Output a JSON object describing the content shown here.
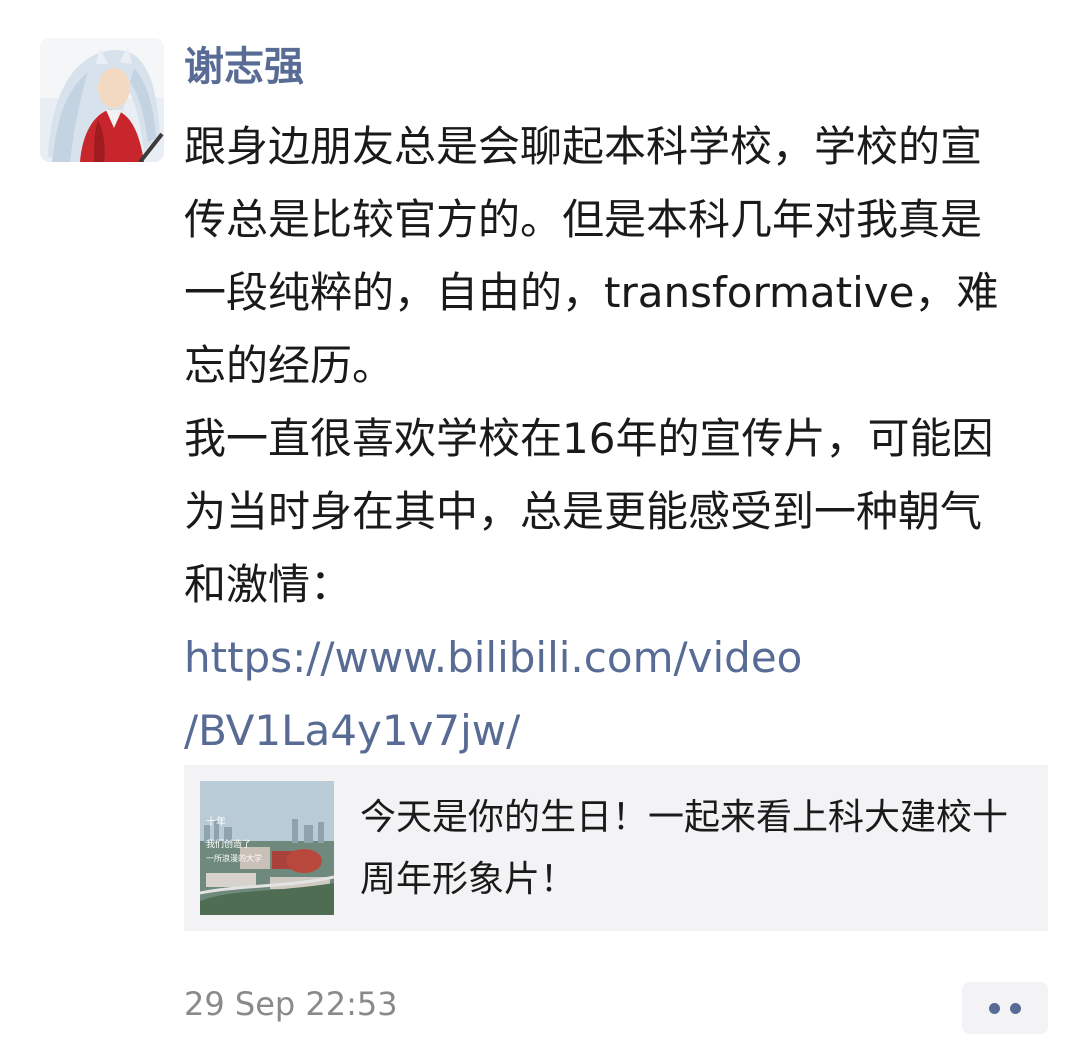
{
  "post": {
    "author": "谢志强",
    "body_lines": [
      "跟身边朋友总是会聊起本科学校，学校的宣",
      "传总是比较官方的。但是本科几年对我真是",
      "一段纯粹的，自由的，transformative，难",
      "忘的经历。",
      "我一直很喜欢学校在16年的宣传片，可能因",
      "为当时身在其中，总是更能感受到一种朝气",
      "和激情："
    ],
    "link_lines": [
      "https://www.bilibili.com/video",
      "/BV1La4y1v7jw/"
    ],
    "share_card": {
      "title_lines": [
        "今天是你的生日！一起来看上科大建校十",
        "周年形象片！"
      ],
      "thumbnail_caption_lines": [
        "十年",
        "我们创造了",
        "一所浪漫的大学"
      ]
    },
    "timestamp": "29 Sep 22:53",
    "more_icon": "two-dots-icon",
    "colors": {
      "link": "#576b95",
      "author": "#576b95",
      "text": "#1a1a1a",
      "timestamp": "#8a8a8a",
      "card_bg": "#f3f3f5"
    }
  }
}
